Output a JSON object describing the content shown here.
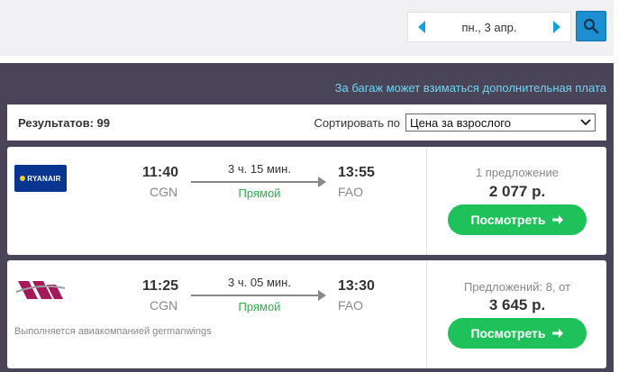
{
  "date_nav": {
    "date": "пн., 3 апр.",
    "prev_icon": "triangle-left-icon",
    "next_icon": "triangle-right-icon"
  },
  "search": {
    "icon": "search-icon"
  },
  "notice": "За багаж может взиматься дополнительная плата",
  "results": {
    "count_label": "Результатов: 99",
    "sort_label": "Сортировать по",
    "sort_value": "Цена за взрослого"
  },
  "flights": [
    {
      "airline": "RYANAIR",
      "dep_time": "11:40",
      "dep_code": "CGN",
      "duration": "3 ч. 15 мин.",
      "stops": "Прямой",
      "arr_time": "13:55",
      "arr_code": "FAO",
      "offers": "1 предложение",
      "price": "2 077 р.",
      "button": "Посмотреть"
    },
    {
      "operated_by": "Выполняется авиакомпанией germanwings",
      "dep_time": "11:25",
      "dep_code": "CGN",
      "duration": "3 ч. 05 мин.",
      "stops": "Прямой",
      "arr_time": "13:30",
      "arr_code": "FAO",
      "offers": "Предложений: 8, от",
      "price": "3 645 р.",
      "button": "Посмотреть"
    }
  ],
  "colors": {
    "panel": "#4a4459",
    "accent_blue": "#1d8fd0",
    "green": "#1fc25a",
    "notice": "#6fd3f2"
  }
}
